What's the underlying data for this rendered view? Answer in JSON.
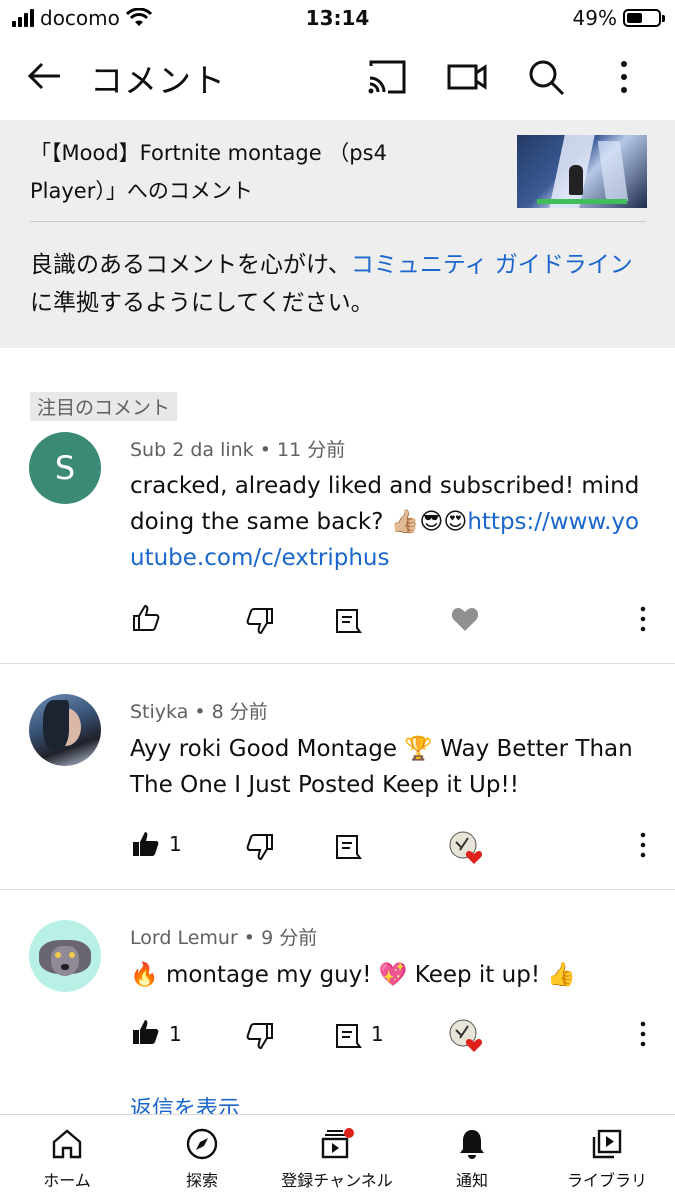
{
  "status_bar": {
    "carrier": "docomo",
    "time": "13:14",
    "battery": "49%",
    "battery_level": 0.49
  },
  "app_bar": {
    "title": "コメント",
    "icons": [
      "back-arrow-icon",
      "cast-icon",
      "camera-icon",
      "search-icon",
      "more-vert-icon"
    ]
  },
  "header": {
    "video_title": "「【Mood】Fortnite montage （ps4 Player）」へのコメント",
    "guideline_prefix": "良識のあるコメントを心がけ、",
    "guideline_link": "コミュニティ ガイドライン",
    "guideline_suffix": "に準拠するようにしてください。"
  },
  "pinned_label": "注目のコメント",
  "comments": [
    {
      "avatar_letter": "S",
      "avatar_color": "#3b8a76",
      "author": "Sub 2 da link",
      "time": "11 分前",
      "text": "cracked, already liked and subscribed! mind doing the same back? 👍🏼😎😍",
      "link": "https://www.youtube.com/c/extriphus",
      "likes": "",
      "replies": ""
    },
    {
      "author": "Stiyka",
      "time": "8 分前",
      "text": "Ayy roki Good Montage 🏆 Way Better Than The One I Just Posted Keep it Up!!",
      "likes": "1",
      "replies": ""
    },
    {
      "author": "Lord Lemur",
      "time": "9 分前",
      "text": "🔥 montage my guy! 💖 Keep it up! 👍",
      "likes": "1",
      "replies": "1"
    }
  ],
  "show_replies": "返信を表示",
  "bottom_nav": [
    {
      "label": "ホーム",
      "icon": "home-icon"
    },
    {
      "label": "探索",
      "icon": "explore-icon"
    },
    {
      "label": "登録チャンネル",
      "icon": "subscriptions-icon"
    },
    {
      "label": "通知",
      "icon": "notifications-icon"
    },
    {
      "label": "ライブラリ",
      "icon": "library-icon"
    }
  ]
}
